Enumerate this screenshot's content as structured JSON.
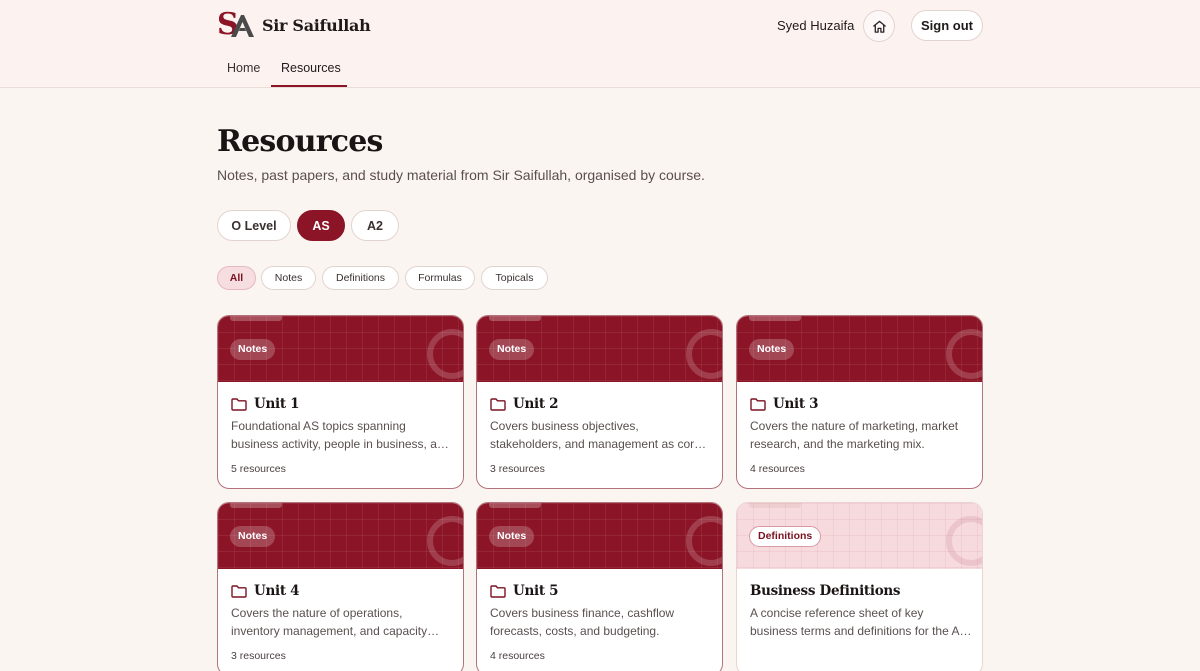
{
  "brand": {
    "logo_letter": "S",
    "name": "Sir Saifullah"
  },
  "header": {
    "user_name": "Syed Huzaifa",
    "home_icon": "home-icon",
    "signout_label": "Sign out"
  },
  "nav": {
    "tabs": [
      {
        "label": "Home"
      },
      {
        "label": "Resources"
      }
    ]
  },
  "page": {
    "title": "Resources",
    "subtitle": "Notes, past papers, and study material from Sir Saifullah, organised by course."
  },
  "levels": [
    {
      "label": "O Level"
    },
    {
      "label": "AS"
    },
    {
      "label": "A2"
    }
  ],
  "filters": [
    {
      "label": "All"
    },
    {
      "label": "Notes"
    },
    {
      "label": "Definitions"
    },
    {
      "label": "Formulas"
    },
    {
      "label": "Topicals"
    }
  ],
  "cards": [
    {
      "badge": "Notes",
      "title": "Unit 1",
      "desc": "Foundational AS topics spanning business activity, people in business, and more.",
      "count": "5 resources"
    },
    {
      "badge": "Notes",
      "title": "Unit 2",
      "desc": "Covers business objectives, stakeholders, and management as core topics.",
      "count": "3 resources"
    },
    {
      "badge": "Notes",
      "title": "Unit 3",
      "desc": "Covers the nature of marketing, market research, and the marketing mix.",
      "count": "4 resources"
    },
    {
      "badge": "Notes",
      "title": "Unit 4",
      "desc": "Covers the nature of operations, inventory management, and capacity utilisation.",
      "count": "3 resources"
    },
    {
      "badge": "Notes",
      "title": "Unit 5",
      "desc": "Covers business finance, cashflow forecasts, costs, and budgeting.",
      "count": "4 resources"
    },
    {
      "badge": "Definitions",
      "title": "Business Definitions",
      "desc": "A concise reference sheet of key business terms and definitions for the AS course.",
      "count": ""
    }
  ],
  "colors": {
    "accent": "#8b1426",
    "background": "#fbf5f2",
    "chip_active": "#f6dde0"
  }
}
